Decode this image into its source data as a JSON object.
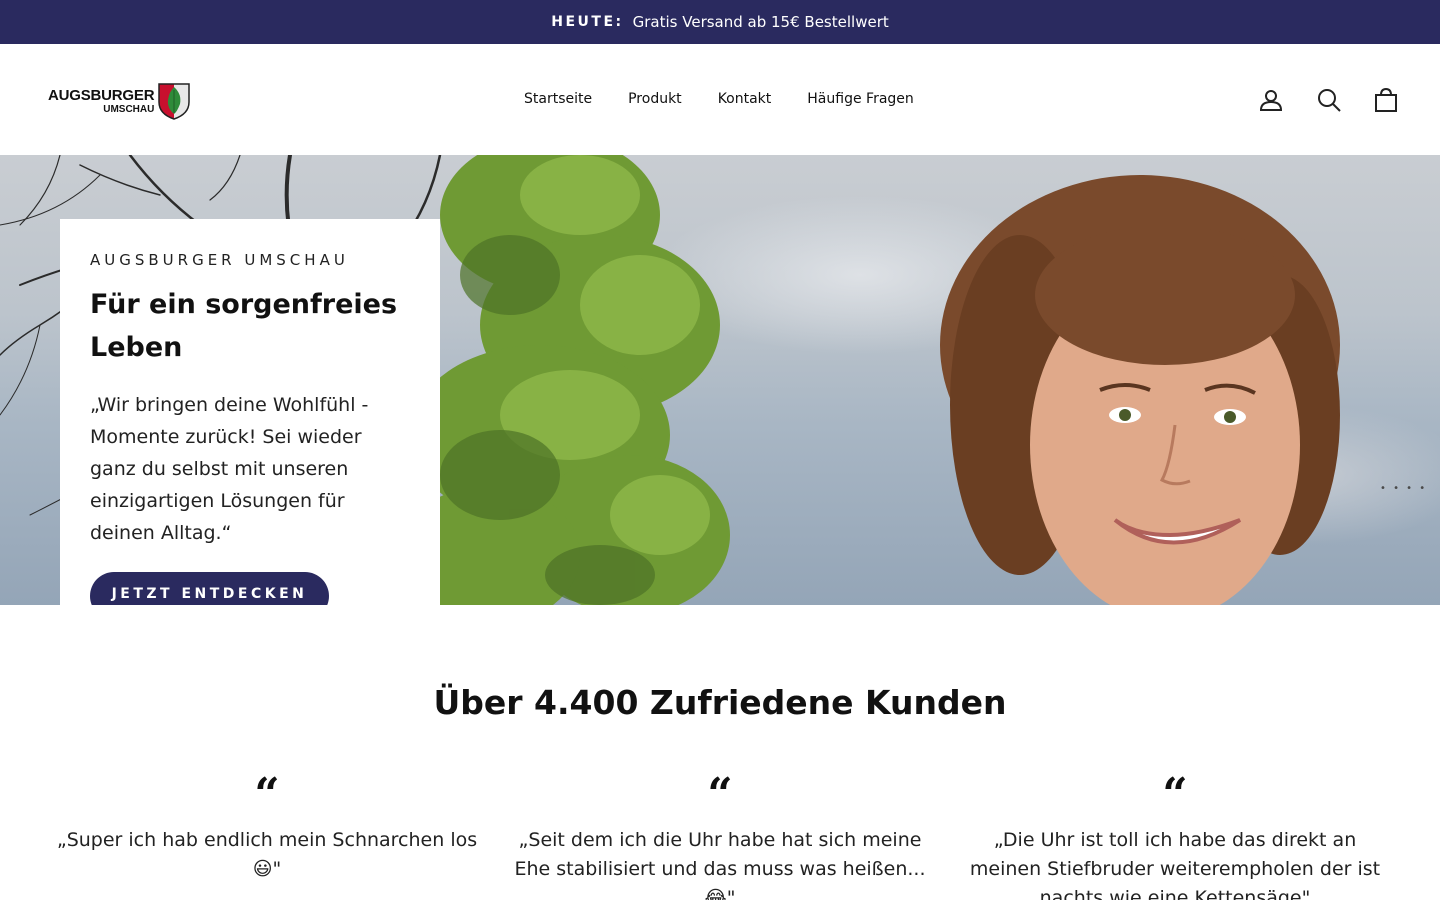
{
  "announcement": {
    "lead": "HEUTE:",
    "text": "Gratis Versand ab 15€ Bestellwert",
    "background": "#2a2a5f"
  },
  "header": {
    "logo": {
      "line1": "AUGSBURGER",
      "line2": "UMSCHAU",
      "crest_icon": "augsburg-crest-icon"
    },
    "nav": [
      "Startseite",
      "Produkt",
      "Kontakt",
      "Häufige Fragen"
    ],
    "icons": [
      "account-icon",
      "search-icon",
      "cart-icon"
    ]
  },
  "hero": {
    "kicker": "AUGSBURGER UMSCHAU",
    "headline": "Für ein sorgenfreies Leben",
    "quote": "„Wir bringen deine Wohlfühl - Momente zurück! Sei wieder ganz du selbst mit unseren einzigartigen Lösungen für deinen Alltag.“",
    "cta": "JETZT ENTDECKEN",
    "cta_color": "#2a2a5f",
    "slider_dots": "• • • •"
  },
  "reviews": {
    "title": "Über 4.400 Zufriedene Kunden",
    "quote_mark": "“",
    "items": [
      {
        "text": "„Super ich hab endlich mein Schnarchen los 😃\""
      },
      {
        "text": "„Seit dem ich die Uhr habe hat sich meine Ehe stabilisiert und das muss was heißen... 😂\""
      },
      {
        "text": "„Die Uhr ist toll ich habe das direkt an meinen Stiefbruder weiterempholen der ist nachts wie eine Kettensäge\""
      }
    ]
  }
}
